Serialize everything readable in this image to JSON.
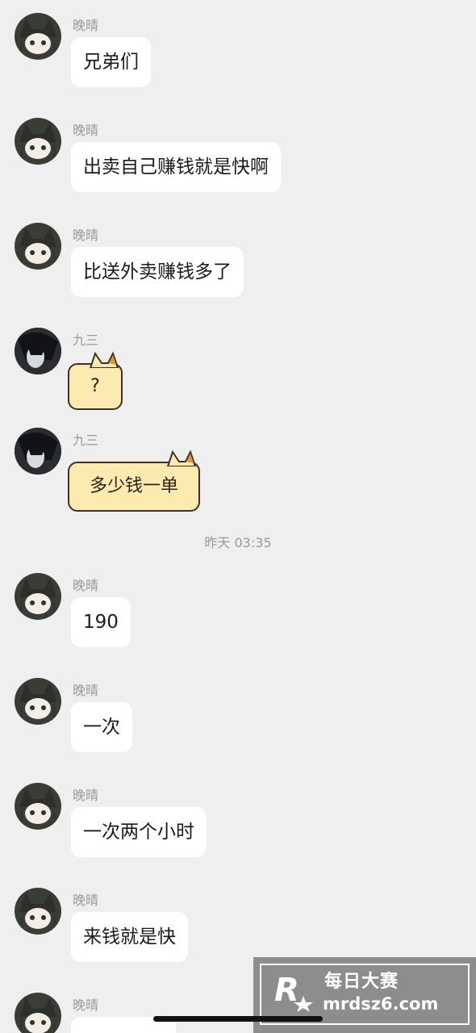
{
  "messages": [
    {
      "sender": "晚晴",
      "text": "兄弟们"
    },
    {
      "sender": "晚晴",
      "text": "出卖自己赚钱就是快啊"
    },
    {
      "sender": "晚晴",
      "text": "比送外卖赚钱多了"
    },
    {
      "sender": "九三",
      "text": "?"
    },
    {
      "sender": "九三",
      "text": "多少钱一单"
    },
    {
      "sender": "晚晴",
      "text": "190"
    },
    {
      "sender": "晚晴",
      "text": "一次"
    },
    {
      "sender": "晚晴",
      "text": "一次两个小时"
    },
    {
      "sender": "晚晴",
      "text": "来钱就是快"
    },
    {
      "sender": "晚晴",
      "text": ""
    }
  ],
  "timestamp": "昨天 03:35",
  "watermark": {
    "title": "每日大赛",
    "url": "mrdsz6.com"
  },
  "colors": {
    "background": "#efefef",
    "bubble": "#ffffff",
    "cat_bubble": "#fdeab0",
    "name": "#9a9a9a"
  },
  "icons": {
    "avatar_wanqing": "anime-girl-avatar",
    "avatar_jiusan": "dark-hair-avatar",
    "cat_bubble": "cat-ears-bubble"
  }
}
